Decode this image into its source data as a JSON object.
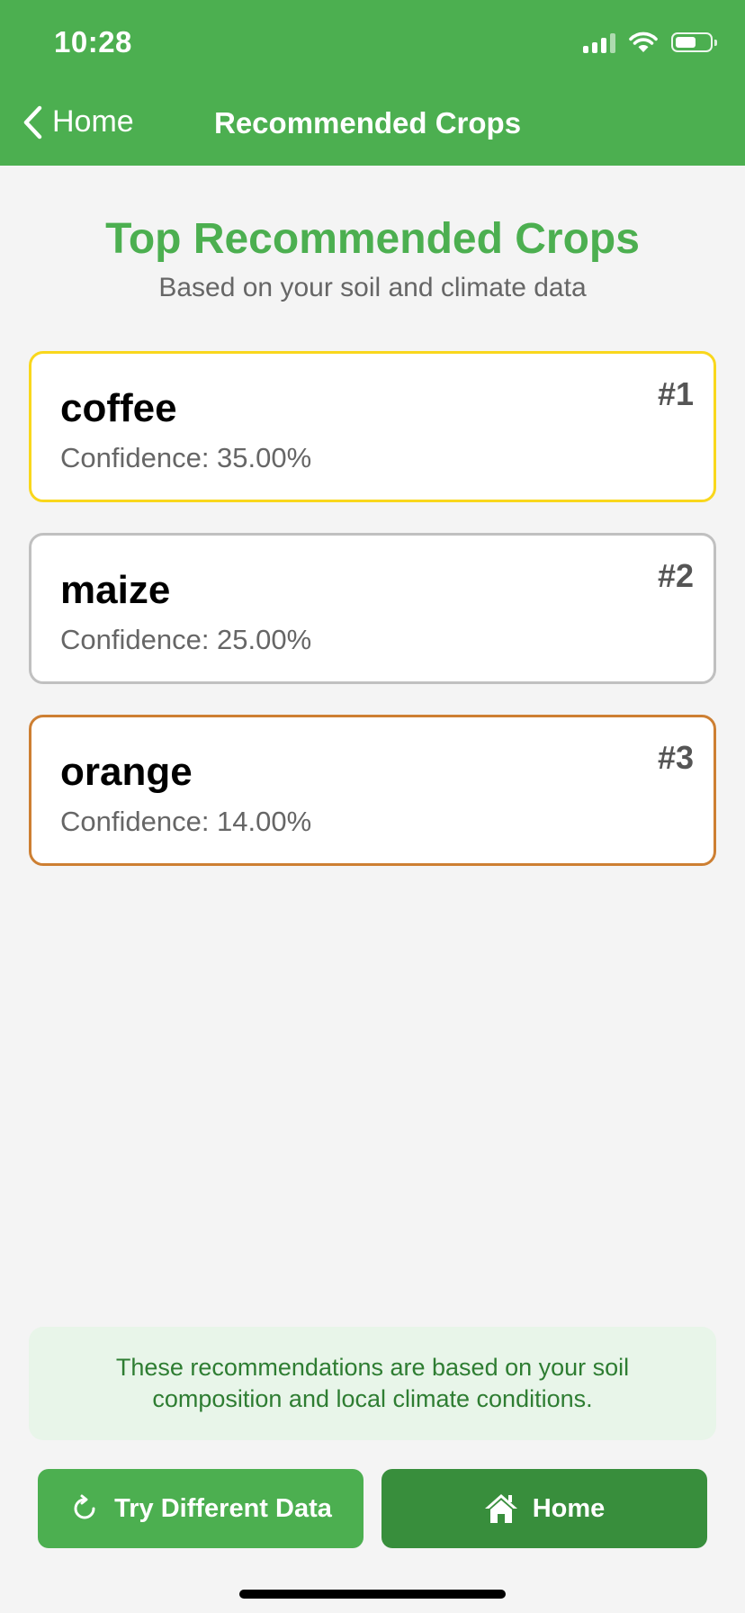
{
  "status_bar": {
    "time": "10:28",
    "battery_level": 0.6
  },
  "nav": {
    "back_label": "Home",
    "title": "Recommended Crops"
  },
  "page": {
    "title": "Top Recommended Crops",
    "subtitle": "Based on your soil and climate data"
  },
  "crops": [
    {
      "name": "coffee",
      "confidence": "Confidence: 35.00%",
      "rank": "#1",
      "border_color": "#f9d71c"
    },
    {
      "name": "maize",
      "confidence": "Confidence: 25.00%",
      "rank": "#2",
      "border_color": "#c0c0c0"
    },
    {
      "name": "orange",
      "confidence": "Confidence: 14.00%",
      "rank": "#3",
      "border_color": "#cd7f32"
    }
  ],
  "note": "These recommendations are based on your soil composition and local climate conditions.",
  "actions": {
    "try_label": "Try Different Data",
    "home_label": "Home"
  },
  "colors": {
    "accent": "#4caf50",
    "accent_dark": "#388e3c",
    "note_bg": "#e8f5e9",
    "note_text": "#2e7d32"
  }
}
